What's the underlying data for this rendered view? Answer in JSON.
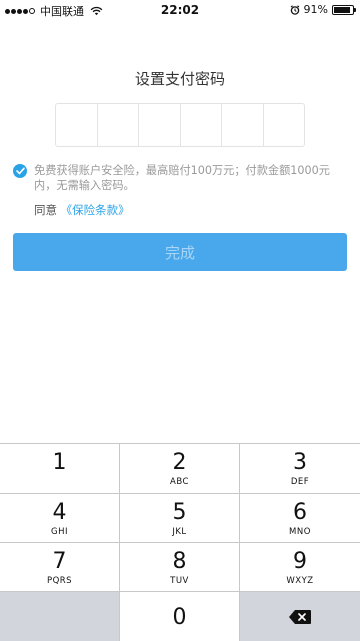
{
  "status_bar": {
    "carrier": "中国联通",
    "time": "22:02",
    "battery": "91%",
    "battery_level": 0.91
  },
  "title": "设置支付密码",
  "pin": {
    "length": 6
  },
  "insurance": {
    "checked": true,
    "note": "免费获得账户安全险，最高赔付100万元；付款金额1000元内，无需输入密码。",
    "agree_text": "同意",
    "terms_link": "《保险条款》"
  },
  "done_label": "完成",
  "colors": {
    "accent": "#2aa3e6",
    "button_bg": "#49a8ec",
    "button_text": "#a9d6f6",
    "key_gray": "#d2d5db"
  },
  "keypad": {
    "keys": [
      {
        "num": "1",
        "letters": ""
      },
      {
        "num": "2",
        "letters": "ABC"
      },
      {
        "num": "3",
        "letters": "DEF"
      },
      {
        "num": "4",
        "letters": "GHI"
      },
      {
        "num": "5",
        "letters": "JKL"
      },
      {
        "num": "6",
        "letters": "MNO"
      },
      {
        "num": "7",
        "letters": "PQRS"
      },
      {
        "num": "8",
        "letters": "TUV"
      },
      {
        "num": "9",
        "letters": "WXYZ"
      },
      {
        "num": "0",
        "letters": ""
      }
    ],
    "delete_icon": "backspace-icon"
  }
}
